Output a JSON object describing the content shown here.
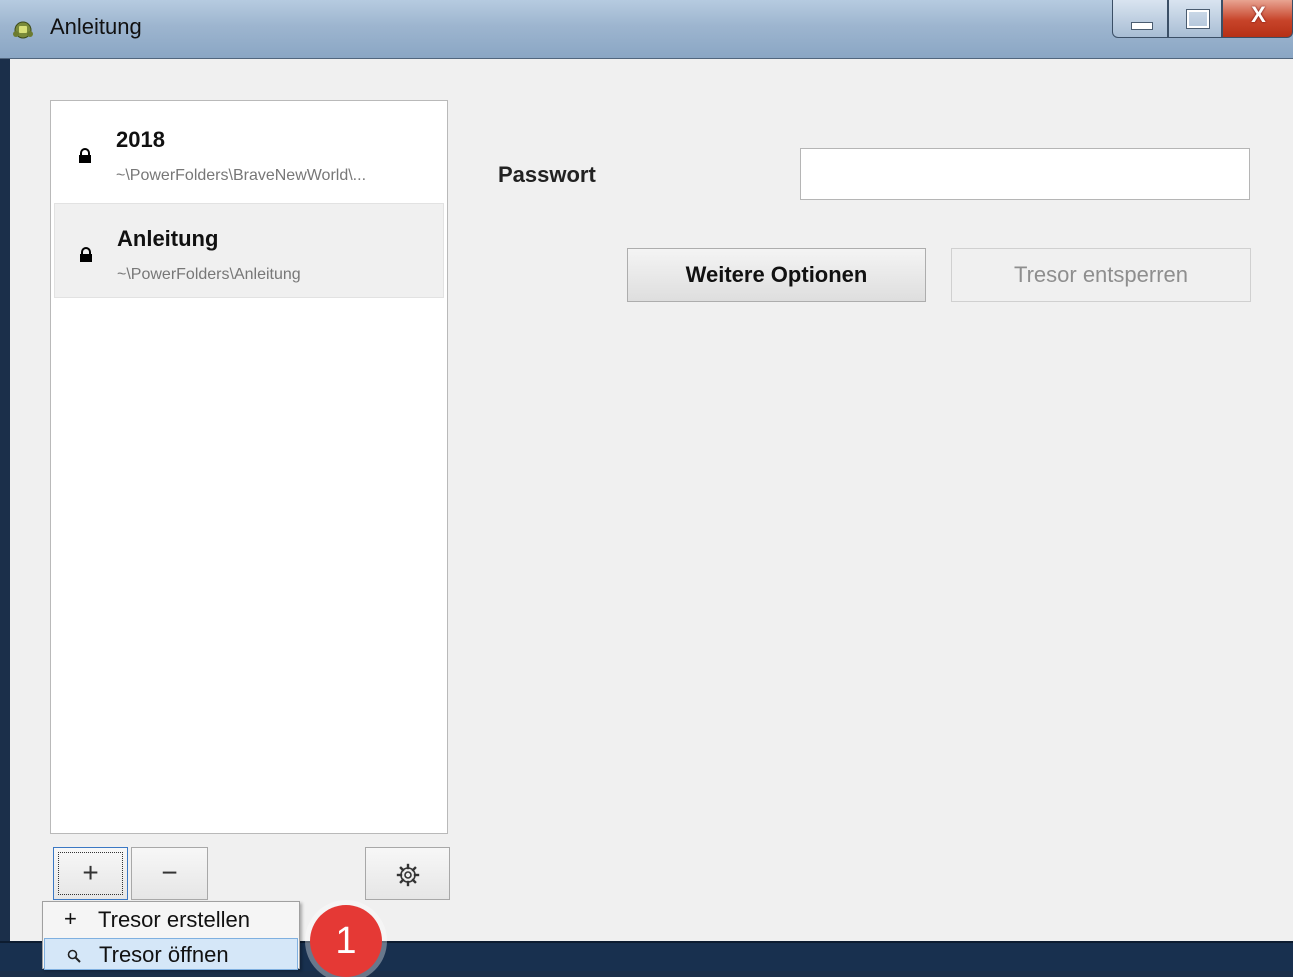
{
  "window": {
    "title": "Anleitung",
    "controls": {
      "close_glyph": "X"
    }
  },
  "vaults": [
    {
      "name": "2018",
      "path": "~\\PowerFolders\\BraveNewWorld\\...",
      "icon": "lock-icon",
      "selected": false
    },
    {
      "name": "Anleitung",
      "path": "~\\PowerFolders\\Anleitung",
      "icon": "lock-icon",
      "selected": true
    }
  ],
  "list_toolbar": {
    "add_label": "+",
    "remove_label": "−",
    "settings_icon": "gear-icon"
  },
  "unlock_panel": {
    "password_label": "Passwort",
    "password_value": "",
    "more_options_label": "Weitere Optionen",
    "unlock_label": "Tresor entsperren"
  },
  "add_menu": {
    "items": [
      {
        "icon_glyph": "+",
        "label": "Tresor erstellen"
      },
      {
        "icon": "search-icon",
        "label": "Tresor öffnen"
      }
    ]
  },
  "annotation": {
    "step_number": "1",
    "color": "#e53935"
  },
  "colors": {
    "titlebar": "#9db5cf",
    "close_button": "#c7442a",
    "window_bg": "#f0f0f0",
    "menu_highlight": "#d5e7f8"
  }
}
